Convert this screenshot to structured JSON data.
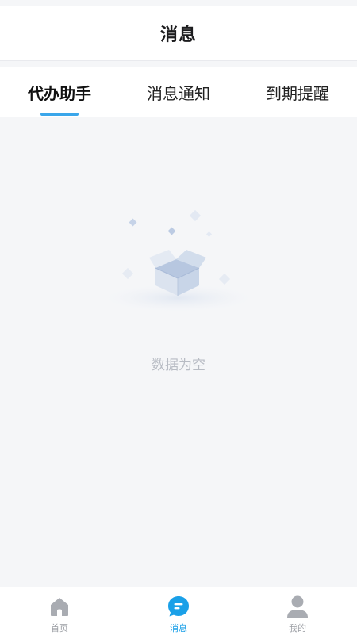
{
  "header": {
    "title": "消息"
  },
  "tabs": [
    {
      "label": "代办助手",
      "active": true
    },
    {
      "label": "消息通知",
      "active": false
    },
    {
      "label": "到期提醒",
      "active": false
    }
  ],
  "empty_state": {
    "text": "数据为空",
    "icon": "empty-box-icon"
  },
  "bottom_nav": [
    {
      "label": "首页",
      "icon": "home-icon",
      "active": false
    },
    {
      "label": "消息",
      "icon": "message-icon",
      "active": true
    },
    {
      "label": "我的",
      "icon": "profile-icon",
      "active": false
    }
  ],
  "colors": {
    "accent": "#1aa0e8",
    "tab_indicator": "#3aa6ea",
    "background": "#f5f6f8",
    "inactive": "#9a9da3"
  }
}
